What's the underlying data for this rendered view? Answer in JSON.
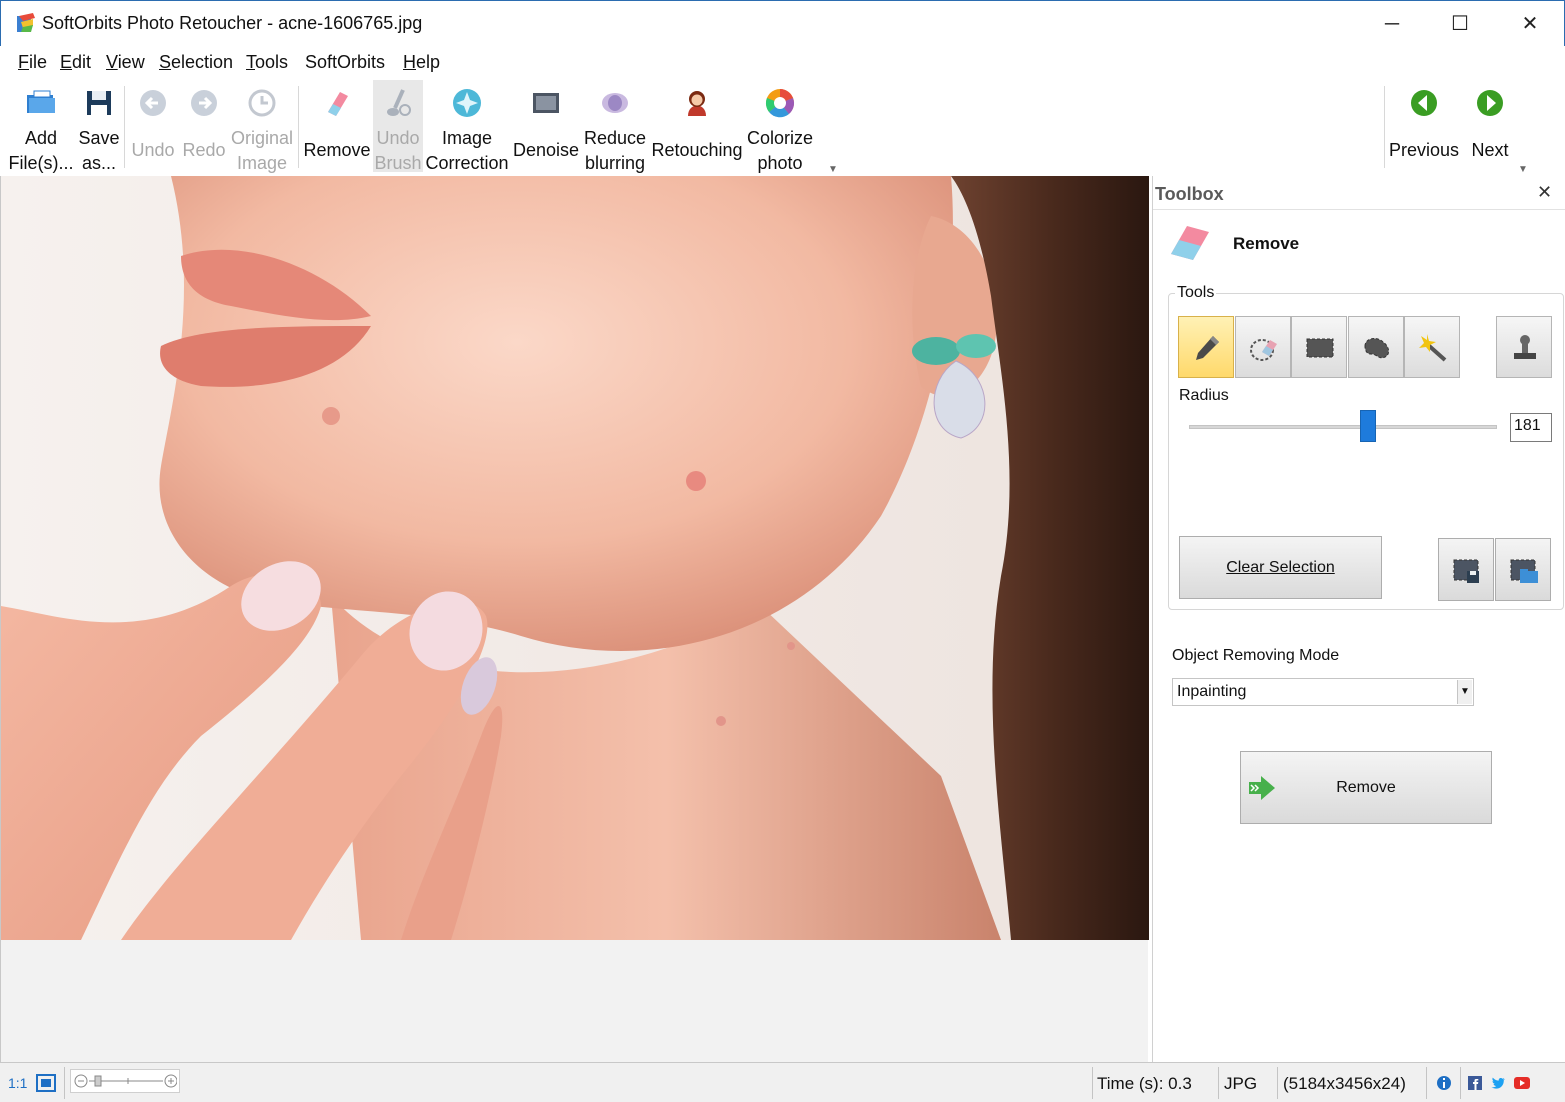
{
  "window": {
    "title": "SoftOrbits Photo Retoucher - acne-1606765.jpg",
    "minimize": "─",
    "maximize": "☐",
    "close": "✕"
  },
  "menu": {
    "items": [
      {
        "pre": "",
        "ul": "F",
        "post": "ile"
      },
      {
        "pre": "",
        "ul": "E",
        "post": "dit"
      },
      {
        "pre": "",
        "ul": "V",
        "post": "iew"
      },
      {
        "pre": "",
        "ul": "S",
        "post": "election"
      },
      {
        "pre": "",
        "ul": "T",
        "post": "ools"
      },
      {
        "pre": "SoftOrbits",
        "ul": "",
        "post": ""
      },
      {
        "pre": "",
        "ul": "H",
        "post": "elp"
      }
    ]
  },
  "ribbon": {
    "add_files": {
      "line1": "Add",
      "line2": "File(s)..."
    },
    "save_as": {
      "line1": "Save",
      "line2": "as..."
    },
    "undo": {
      "label": "Undo"
    },
    "redo": {
      "label": "Redo"
    },
    "original_image": {
      "line1": "Original",
      "line2": "Image"
    },
    "remove": {
      "label": "Remove"
    },
    "undo_brush": {
      "line1": "Undo",
      "line2": "Brush"
    },
    "image_correction": {
      "line1": "Image",
      "line2": "Correction"
    },
    "denoise": {
      "label": "Denoise"
    },
    "reduce_blurring": {
      "line1": "Reduce",
      "line2": "blurring"
    },
    "retouching": {
      "label": "Retouching"
    },
    "colorize_photo": {
      "line1": "Colorize",
      "line2": "photo"
    },
    "previous": {
      "label": "Previous"
    },
    "next": {
      "label": "Next"
    },
    "overflow": "▼"
  },
  "toolbox": {
    "title": "Toolbox",
    "close": "✕",
    "section_title": "Remove",
    "tools_label": "Tools",
    "radius_label": "Radius",
    "radius_value": "181",
    "radius_fraction": 0.58,
    "clear_selection": "Clear Selection",
    "mode_label": "Object Removing Mode",
    "mode_value": "Inpainting",
    "mode_arrow": "▼",
    "remove_button": "Remove"
  },
  "status": {
    "ratio": "1:1",
    "time": "Time (s): 0.3",
    "format": "JPG",
    "dimensions": "(5184x3456x24)"
  },
  "colors": {
    "accent_blue": "#1e7bdc",
    "active_tool": "#ffd96b",
    "nav_green": "#3a9d23"
  }
}
